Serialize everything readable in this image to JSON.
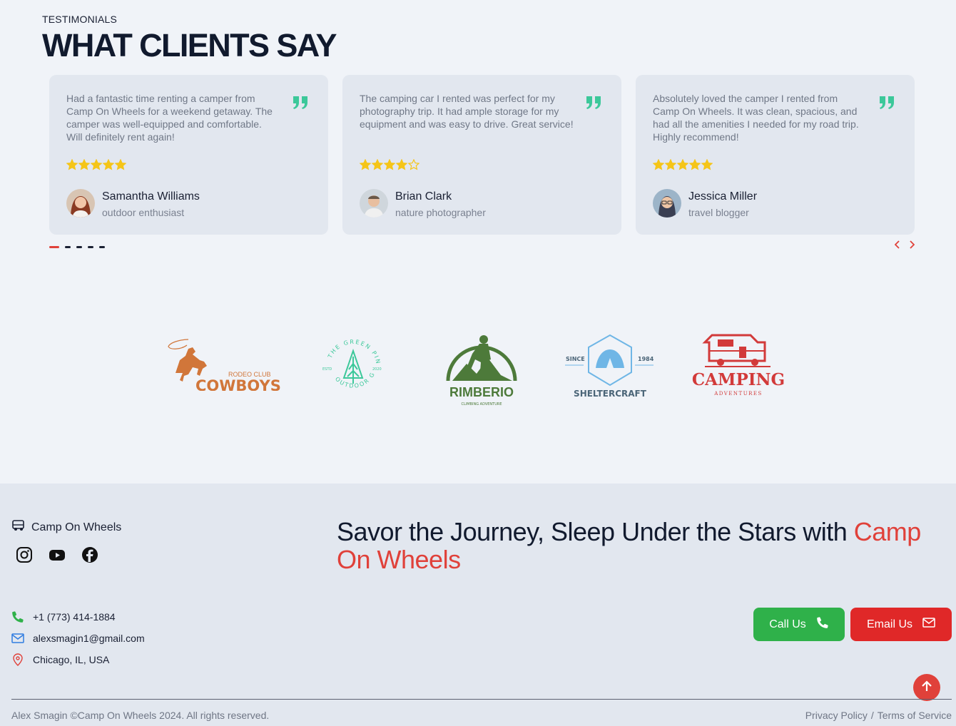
{
  "testimonials": {
    "eyebrow": "TESTIMONIALS",
    "title": "WHAT CLIENTS SAY",
    "cards": [
      {
        "text": "Had a fantastic time renting a camper from Camp On Wheels for a weekend getaway. The camper was well-equipped and comfortable. Will definitely rent again!",
        "rating": 5,
        "name": "Samantha Williams",
        "role": "outdoor enthusiast"
      },
      {
        "text": "The camping car I rented was perfect for my photography trip. It had ample storage for my equipment and was easy to drive. Great service!",
        "rating": 4,
        "name": "Brian Clark",
        "role": "nature photographer"
      },
      {
        "text": "Absolutely loved the camper I rented from Camp On Wheels. It was clean, spacious, and had all the amenities I needed for my road trip. Highly recommend!",
        "rating": 5,
        "name": "Jessica Miller",
        "role": "travel blogger"
      }
    ],
    "pagination": {
      "total": 5,
      "active": 1
    }
  },
  "partners": {
    "cowboys": {
      "line1": "RODEO CLUB",
      "line2": "COWBOYS"
    },
    "greenpine": {
      "top": "THE GREEN PINE",
      "bottom": "OUTDOOR GEAR",
      "left": "ESTD",
      "right": "2020"
    },
    "rimberio": {
      "name": "RIMBERIO",
      "sub": "CLIMBING ADVENTURE"
    },
    "sheltercraft": {
      "name": "SHELTERCRAFT",
      "since": "SINCE",
      "year": "1984"
    },
    "camping": {
      "name": "CAMPING",
      "sub": "ADVENTURES"
    }
  },
  "footer": {
    "brand": "Camp On Wheels",
    "tagline_main": "Savor the Journey, Sleep Under the Stars with ",
    "tagline_accent": "Camp On Wheels",
    "phone": "+1 (773) 414-1884",
    "email": "alexsmagin1@gmail.com",
    "location": "Chicago, IL, USA",
    "call_label": "Call Us",
    "email_label": "Email Us",
    "copyright": "Alex Smagin ©Camp On Wheels 2024. All rights reserved.",
    "privacy": "Privacy Policy",
    "separator": "/",
    "terms": "Terms of Service"
  },
  "colors": {
    "accent": "#e0413a",
    "star": "#f5c518",
    "quote": "#3cc89a",
    "call": "#2fb14a",
    "email": "#e02828"
  }
}
